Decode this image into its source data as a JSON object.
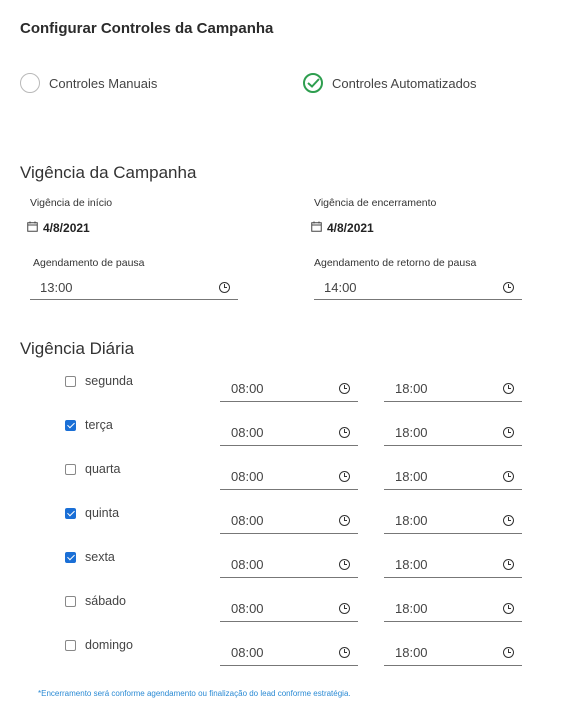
{
  "title": "Configurar Controles da Campanha",
  "mode_options": [
    {
      "label": "Controles Manuais",
      "selected": false
    },
    {
      "label": "Controles Automatizados",
      "selected": true
    }
  ],
  "campaign_period": {
    "title": "Vigência da Campanha",
    "start_label": "Vigência de início",
    "start_date": "4/8/2021",
    "end_label": "Vigência de encerramento",
    "end_date": "4/8/2021",
    "pause_label": "Agendamento de pausa",
    "pause_time": "13:00",
    "resume_label": "Agendamento de retorno de pausa",
    "resume_time": "14:00"
  },
  "daily_period": {
    "title": "Vigência Diária",
    "days": [
      {
        "label": "segunda",
        "checked": false,
        "start": "08:00",
        "end": "18:00"
      },
      {
        "label": "terça",
        "checked": true,
        "start": "08:00",
        "end": "18:00"
      },
      {
        "label": "quarta",
        "checked": false,
        "start": "08:00",
        "end": "18:00"
      },
      {
        "label": "quinta",
        "checked": true,
        "start": "08:00",
        "end": "18:00"
      },
      {
        "label": "sexta",
        "checked": true,
        "start": "08:00",
        "end": "18:00"
      },
      {
        "label": "sábado",
        "checked": false,
        "start": "08:00",
        "end": "18:00"
      },
      {
        "label": "domingo",
        "checked": false,
        "start": "08:00",
        "end": "18:00"
      }
    ]
  },
  "footnote": "*Encerramento será conforme agendamento ou finalização do lead conforme estratégia.",
  "colors": {
    "accent_green": "#2e9e4f",
    "checkbox_blue": "#1a6fd6",
    "footnote_blue": "#2a8ad4"
  }
}
